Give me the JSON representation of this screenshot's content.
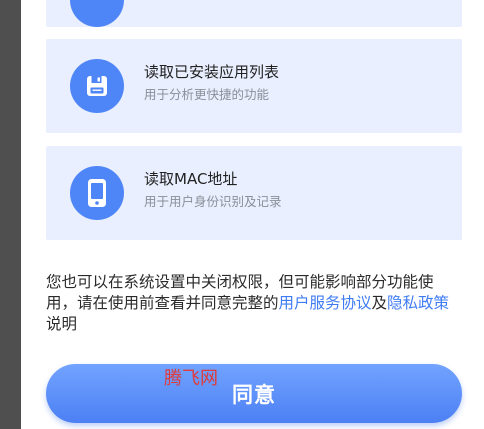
{
  "permissions": [
    {
      "icon": "partial-icon",
      "title": "",
      "subtitle": ""
    },
    {
      "icon": "floppy-disk-icon",
      "title": "读取已安装应用列表",
      "subtitle": "用于分析更快捷的功能"
    },
    {
      "icon": "phone-icon",
      "title": "读取MAC地址",
      "subtitle": "用于用户身份识别及记录"
    }
  ],
  "notice": {
    "text_1": "您也可以在系统设置中关闭权限，但可能影响部分功能使用，请在使用前查看并同意完整的",
    "link_service": "用户服务协议",
    "text_and": "及",
    "link_privacy": "隐私政策",
    "text_end": "说明"
  },
  "agree_button": {
    "label": "同意"
  },
  "watermark": {
    "text": "腾飞网"
  },
  "colors": {
    "accent": "#4f86f7",
    "card_bg": "#e9efff",
    "link": "#3f7cf4"
  }
}
